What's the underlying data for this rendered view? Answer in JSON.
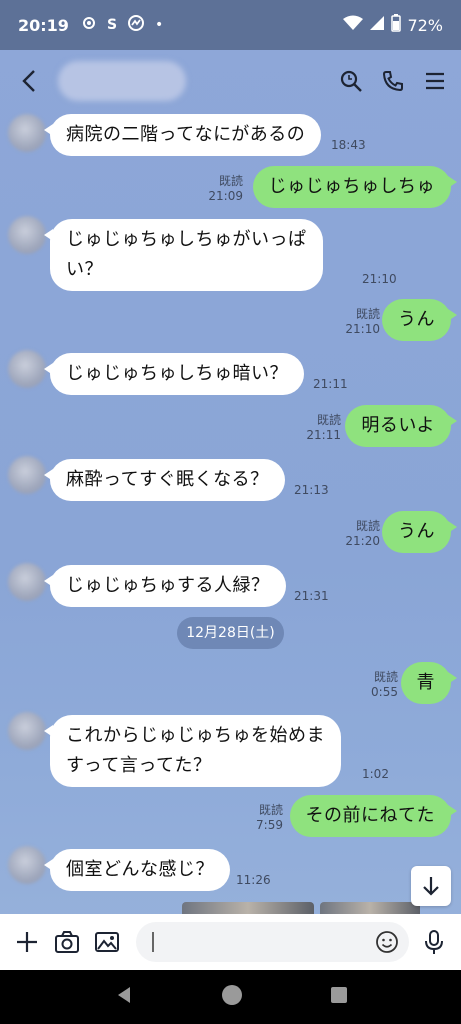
{
  "status_bar": {
    "time": "20:19",
    "icons": [
      "settings-gear-icon",
      "s-app-icon",
      "messenger-icon",
      "dot-icon"
    ],
    "battery_percent": "72%"
  },
  "header": {
    "contact_name_blurred": true,
    "actions": [
      "search-icon",
      "call-icon",
      "menu-icon"
    ]
  },
  "messages": [
    {
      "dir": "in",
      "text": "病院の二階ってなにがあるの",
      "time": "18:43"
    },
    {
      "dir": "out",
      "text": "じゅじゅちゅしちゅ",
      "read": "既読",
      "time": "21:09"
    },
    {
      "dir": "in",
      "text_lines": [
        "じゅじゅちゅしちゅがいっぱ",
        "い？"
      ],
      "time": "21:10"
    },
    {
      "dir": "out",
      "text": "うん",
      "read": "既読",
      "time": "21:10"
    },
    {
      "dir": "in",
      "text": "じゅじゅちゅしちゅ暗い？",
      "time": "21:11"
    },
    {
      "dir": "out",
      "text": "明るいよ",
      "read": "既読",
      "time": "21:11"
    },
    {
      "dir": "in",
      "text": "麻酔ってすぐ眠くなる？",
      "time": "21:13"
    },
    {
      "dir": "out",
      "text": "うん",
      "read": "既読",
      "time": "21:20"
    },
    {
      "dir": "in",
      "text": "じゅじゅちゅする人緑？",
      "time": "21:31"
    },
    {
      "dir": "out",
      "text": "青",
      "read": "既読",
      "time": "0:55"
    },
    {
      "dir": "in",
      "text_lines": [
        "これからじゅじゅちゅを始めま",
        "すって言ってた？"
      ],
      "time": "1:02"
    },
    {
      "dir": "out",
      "text": "その前にねてた",
      "read": "既読",
      "time": "7:59"
    },
    {
      "dir": "in",
      "text": "個室どんな感じ？",
      "time": "11:26"
    }
  ],
  "date_separator": "12月28日(土)",
  "input": {
    "value": "",
    "left_icons": [
      "plus-icon",
      "camera-icon",
      "image-icon"
    ],
    "right_icon": "mic-icon"
  },
  "nav": [
    "back-triangle-icon",
    "home-circle-icon",
    "recents-square-icon"
  ],
  "colors": {
    "chat_bg": "#8ea7d8",
    "outgoing_bubble": "#8fe27e",
    "incoming_bubble": "#ffffff",
    "status_bar": "#5d7197"
  }
}
